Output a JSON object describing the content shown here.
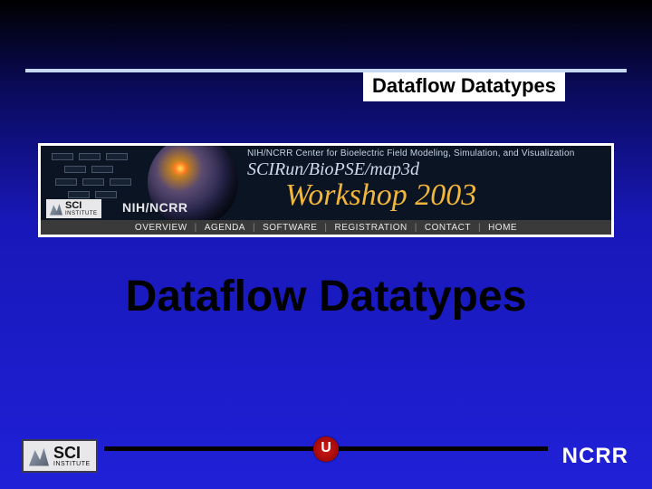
{
  "header": {
    "tag": "Dataflow Datatypes"
  },
  "banner": {
    "tagline": "NIH/NCRR Center for Bioelectric Field Modeling, Simulation, and Visualization",
    "title": "SCIRun/BioPSE/map3d",
    "workshop": "Workshop 2003",
    "sci_badge_text": "SCI",
    "sci_badge_sub": "INSTITUTE",
    "nih_label": "NIH/NCRR",
    "nav": [
      "OVERVIEW",
      "AGENDA",
      "SOFTWARE",
      "REGISTRATION",
      "CONTACT",
      "HOME"
    ]
  },
  "main": {
    "title": "Dataflow Datatypes"
  },
  "footer": {
    "sci_text": "SCI",
    "sci_sub": "INSTITUTE",
    "u_glyph": "U",
    "ncrr": "NCRR"
  }
}
